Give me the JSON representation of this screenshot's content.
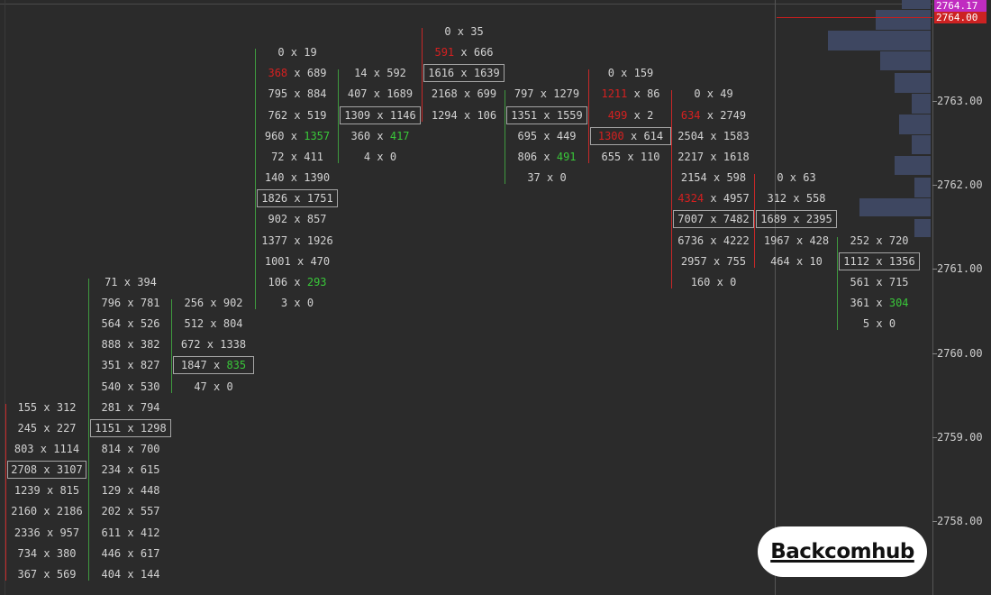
{
  "current_price": "2764.00",
  "top_price": "2764.17",
  "price_labels": [
    "2763.00",
    "2762.00",
    "2761.00",
    "2760.00",
    "2759.00",
    "2758.00"
  ],
  "colors": {
    "background": "#2b2b2b",
    "text": "#d2d2d2",
    "ask_red": "#d52020",
    "bid_green": "#39c739",
    "profile_bar": "#3e4761",
    "current_price_box": "#cc2222",
    "top_price_box": "#c02cc0"
  },
  "brand": {
    "logo_text": "Backcomhub"
  },
  "columns": [
    {
      "id": "c1",
      "border": "#c62828",
      "cells": [
        {
          "b": "155",
          "a": "312"
        },
        {
          "b": "245",
          "a": "227"
        },
        {
          "b": "803",
          "a": "1114"
        },
        {
          "b": "2708",
          "a": "3107",
          "poc": true
        },
        {
          "b": "1239",
          "a": "815"
        },
        {
          "b": "2160",
          "a": "2186"
        },
        {
          "b": "2336",
          "a": "957"
        },
        {
          "b": "734",
          "a": "380"
        },
        {
          "b": "367",
          "a": "569"
        }
      ]
    },
    {
      "id": "c2",
      "border": "#3f9a3f",
      "cells": [
        {
          "b": "71",
          "a": "394"
        },
        {
          "b": "796",
          "a": "781"
        },
        {
          "b": "564",
          "a": "526"
        },
        {
          "b": "888",
          "a": "382"
        },
        {
          "b": "351",
          "a": "827"
        },
        {
          "b": "540",
          "a": "530"
        },
        {
          "b": "281",
          "a": "794"
        },
        {
          "b": "1151",
          "a": "1298",
          "poc": true
        },
        {
          "b": "814",
          "a": "700"
        },
        {
          "b": "234",
          "a": "615"
        },
        {
          "b": "129",
          "a": "448"
        },
        {
          "b": "202",
          "a": "557"
        },
        {
          "b": "611",
          "a": "412"
        },
        {
          "b": "446",
          "a": "617"
        },
        {
          "b": "404",
          "a": "144"
        }
      ]
    },
    {
      "id": "c3",
      "border": "#3f9a3f",
      "cells": [
        {
          "b": "256",
          "a": "902"
        },
        {
          "b": "512",
          "a": "804"
        },
        {
          "b": "672",
          "a": "1338"
        },
        {
          "b": "1847",
          "a": "835",
          "poc": true,
          "ac": "green"
        },
        {
          "b": "47",
          "a": "0"
        }
      ]
    },
    {
      "id": "c4",
      "border": "#3f9a3f",
      "cells": [
        {
          "b": "0",
          "a": "19"
        },
        {
          "b": "368",
          "a": "689",
          "bc": "red"
        },
        {
          "b": "795",
          "a": "884"
        },
        {
          "b": "762",
          "a": "519"
        },
        {
          "b": "960",
          "a": "1357",
          "ac": "green"
        },
        {
          "b": "72",
          "a": "411"
        },
        {
          "b": "140",
          "a": "1390"
        },
        {
          "b": "1826",
          "a": "1751",
          "poc": true
        },
        {
          "b": "902",
          "a": "857"
        },
        {
          "b": "1377",
          "a": "1926"
        },
        {
          "b": "1001",
          "a": "470"
        },
        {
          "b": "106",
          "a": "293",
          "ac": "green"
        },
        {
          "b": "3",
          "a": "0"
        }
      ]
    },
    {
      "id": "c5",
      "border": "#3f9a3f",
      "cells": [
        {
          "b": "14",
          "a": "592"
        },
        {
          "b": "407",
          "a": "1689"
        },
        {
          "b": "1309",
          "a": "1146",
          "poc": true
        },
        {
          "b": "360",
          "a": "417",
          "ac": "green"
        },
        {
          "b": "4",
          "a": "0"
        }
      ]
    },
    {
      "id": "c6",
      "border": "#c62828",
      "cells": [
        {
          "b": "0",
          "a": "35"
        },
        {
          "b": "591",
          "a": "666",
          "bc": "red"
        },
        {
          "b": "1616",
          "a": "1639",
          "poc": true
        },
        {
          "b": "2168",
          "a": "699"
        },
        {
          "b": "1294",
          "a": "106"
        }
      ]
    },
    {
      "id": "c7",
      "border": "#3f9a3f",
      "cells": [
        {
          "b": "797",
          "a": "1279"
        },
        {
          "b": "1351",
          "a": "1559",
          "poc": true
        },
        {
          "b": "695",
          "a": "449"
        },
        {
          "b": "806",
          "a": "491",
          "ac": "green"
        },
        {
          "b": "37",
          "a": "0"
        }
      ]
    },
    {
      "id": "c8",
      "border": "#c62828",
      "cells": [
        {
          "b": "0",
          "a": "159"
        },
        {
          "b": "1211",
          "a": "86",
          "bc": "red"
        },
        {
          "b": "499",
          "a": "2",
          "bc": "red"
        },
        {
          "b": "1300",
          "a": "614",
          "poc": true,
          "bc": "red"
        },
        {
          "b": "655",
          "a": "110"
        }
      ]
    },
    {
      "id": "c9",
      "border": "#c62828",
      "cells": [
        {
          "b": "0",
          "a": "49"
        },
        {
          "b": "634",
          "a": "2749",
          "bc": "red"
        },
        {
          "b": "2504",
          "a": "1583"
        },
        {
          "b": "2217",
          "a": "1618"
        },
        {
          "b": "2154",
          "a": "598"
        },
        {
          "b": "4324",
          "a": "4957",
          "bc": "red"
        },
        {
          "b": "7007",
          "a": "7482",
          "poc": true
        },
        {
          "b": "6736",
          "a": "4222"
        },
        {
          "b": "2957",
          "a": "755"
        },
        {
          "b": "160",
          "a": "0"
        }
      ]
    },
    {
      "id": "c10",
      "border": "#c62828",
      "cells": [
        {
          "b": "0",
          "a": "63"
        },
        {
          "b": "312",
          "a": "558"
        },
        {
          "b": "1689",
          "a": "2395",
          "poc": true
        },
        {
          "b": "1967",
          "a": "428"
        },
        {
          "b": "464",
          "a": "10"
        }
      ]
    },
    {
      "id": "c11",
      "border": "#3f9a3f",
      "cells": [
        {
          "b": "252",
          "a": "720"
        },
        {
          "b": "1112",
          "a": "1356",
          "poc": true
        },
        {
          "b": "561",
          "a": "715"
        },
        {
          "b": "361",
          "a": "304",
          "ac": "green"
        },
        {
          "b": "5",
          "a": "0"
        }
      ]
    }
  ],
  "volume_profile": [
    0.18,
    0.35,
    0.65,
    0.32,
    0.23,
    0.12,
    0.2,
    0.12,
    0.23,
    0.1,
    0.45,
    0.1
  ]
}
